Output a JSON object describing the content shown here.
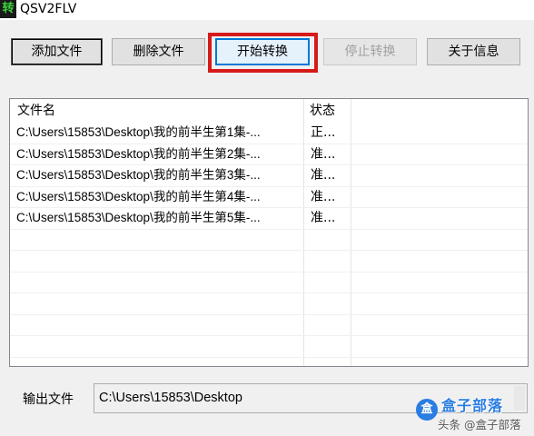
{
  "window": {
    "icon_glyph": "转",
    "title": "QSV2FLV"
  },
  "toolbar": {
    "add_label": "添加文件",
    "delete_label": "删除文件",
    "start_label": "开始转换",
    "stop_label": "停止转换",
    "about_label": "关于信息"
  },
  "list": {
    "columns": [
      "文件名",
      "状态"
    ],
    "rows": [
      {
        "name": "C:\\Users\\15853\\Desktop\\我的前半生第1集-...",
        "status": "正..."
      },
      {
        "name": "C:\\Users\\15853\\Desktop\\我的前半生第2集-...",
        "status": "准..."
      },
      {
        "name": "C:\\Users\\15853\\Desktop\\我的前半生第3集-...",
        "status": "准..."
      },
      {
        "name": "C:\\Users\\15853\\Desktop\\我的前半生第4集-...",
        "status": "准..."
      },
      {
        "name": "C:\\Users\\15853\\Desktop\\我的前半生第5集-...",
        "status": "准..."
      }
    ]
  },
  "output": {
    "label": "输出文件",
    "path": "C:\\Users\\15853\\Desktop"
  },
  "watermark": {
    "brand": "盒子部落",
    "credit": "头条 @盒子部落"
  },
  "colors": {
    "highlight": "#d61a1a",
    "accent": "#0078d7",
    "brand": "#2a7de1"
  }
}
